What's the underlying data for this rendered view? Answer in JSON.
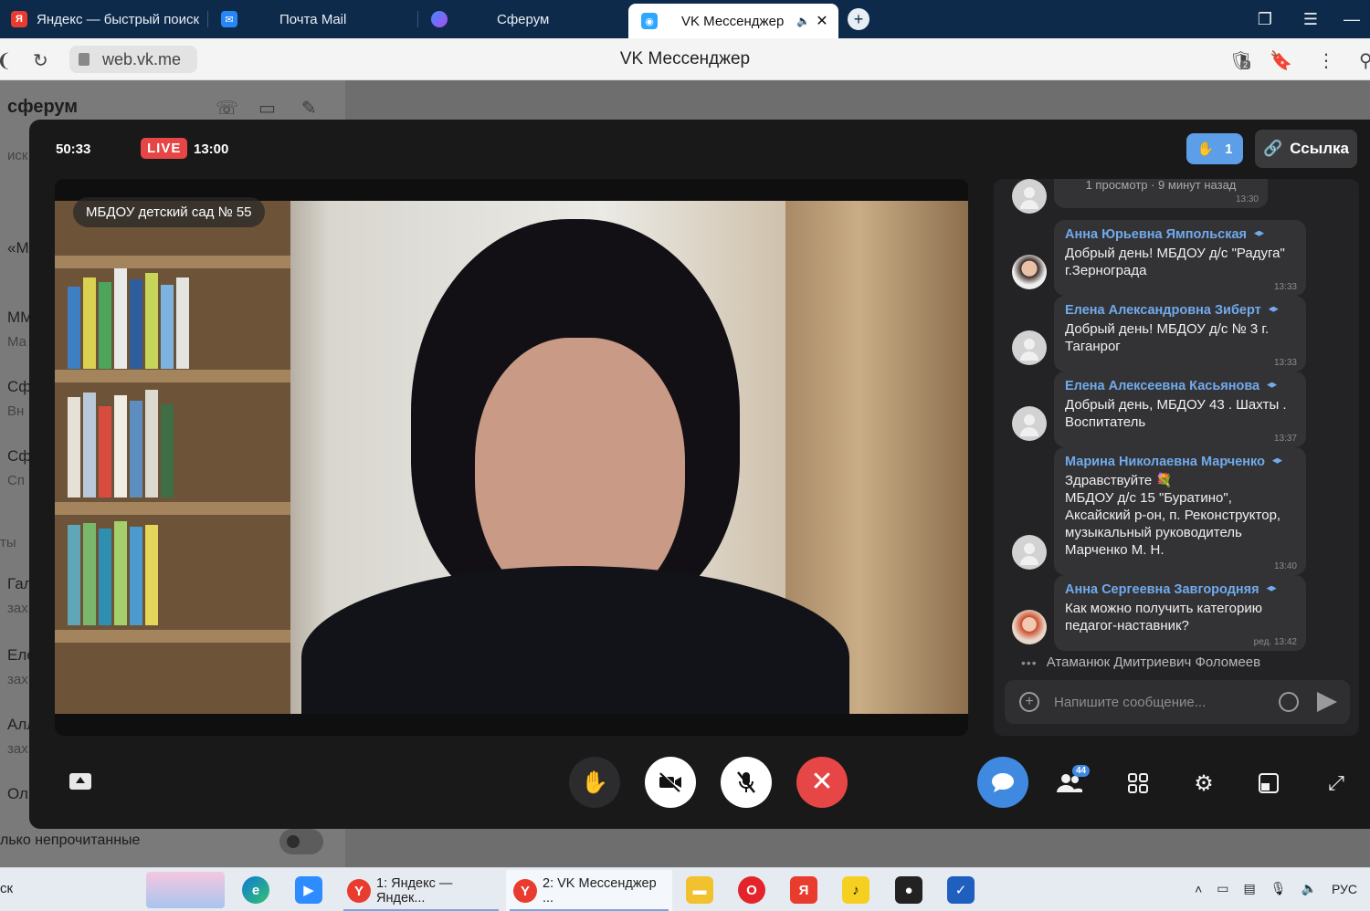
{
  "browser": {
    "tabs": [
      {
        "label": "Яндекс — быстрый поиск",
        "icon": "yandex-icon",
        "color": "#e93c2f"
      },
      {
        "label": "Почта Mail",
        "icon": "mail-icon",
        "color": "#2787f5"
      },
      {
        "label": "Сферум",
        "icon": "sferum-icon",
        "color": "#7a4ef0"
      },
      {
        "label": "VK Мессенджер",
        "icon": "vk-messenger-icon",
        "color": "#2ea7ff"
      }
    ],
    "url": "web.vk.me",
    "page_title": "VK Мессенджер",
    "bookmark_badge": "2"
  },
  "underlay": {
    "channel_title": "сферум",
    "search_hint": "иск",
    "items": [
      "«М",
      "ММ",
      "Ма",
      "Сф",
      "Вн",
      "Сф",
      "Сп",
      "ты",
      "Гал",
      "зах",
      "Еле",
      "зах",
      "Алл",
      "зах",
      "Оль"
    ],
    "unread_label": "лько непрочитанные"
  },
  "call": {
    "duration": "50:33",
    "live_label": "LIVE",
    "live_time": "13:00",
    "raised_hands": "1",
    "link_label": "Ссылка",
    "speaker_name": "МБДОУ детский сад № 55"
  },
  "chat": {
    "partial_message": {
      "text": "1 просмотр · 9 минут назад",
      "time": "13:30"
    },
    "messages": [
      {
        "author": "Анна Юрьевна Ямпольская",
        "text": "Добрый день! МБДОУ д/с \"Радуга\" г.Зернограда",
        "time": "13:33",
        "avatar": "photo"
      },
      {
        "author": "Елена Александровна Зиберт",
        "text": "Добрый день! МБДОУ  д/с № 3 г. Таганрог",
        "time": "13:33",
        "avatar": "default"
      },
      {
        "author": "Елена Алексеевна Касьянова",
        "text": "Добрый день, МБДОУ 43 . Шахты . Воспитатель",
        "time": "13:37",
        "avatar": "default"
      },
      {
        "author": "Марина Николаевна Марченко",
        "text": "Здравствуйте 💐\nМБДОУ д/с 15 \"Буратино\",\nАксайский р-он, п. Реконструктор,\nмузыкальный руководитель\nМарченко М. Н.",
        "time": "13:40",
        "avatar": "default"
      },
      {
        "author": "Анна Сергеевна Завгородняя",
        "text": "Как можно получить категорию педагог-наставник?",
        "time": "ред.  13:42",
        "avatar": "photo"
      }
    ],
    "typing_user": "Атаманюк Дмитриевич Фоломеев",
    "typing_dots": "•••",
    "compose_placeholder": "Напишите сообщение..."
  },
  "controls": {
    "participants_count": "44",
    "buttons": [
      "share-screen",
      "raise-hand",
      "camera-off",
      "mic-off",
      "end-call",
      "chat",
      "participants",
      "grid",
      "settings",
      "layout",
      "fullscreen"
    ]
  },
  "taskbar": {
    "search_text": "ск",
    "tasks": [
      {
        "label": "1: Яндекс — Яндек..."
      },
      {
        "label": "2: VK Мессенджер ..."
      }
    ],
    "language": "РУС"
  }
}
